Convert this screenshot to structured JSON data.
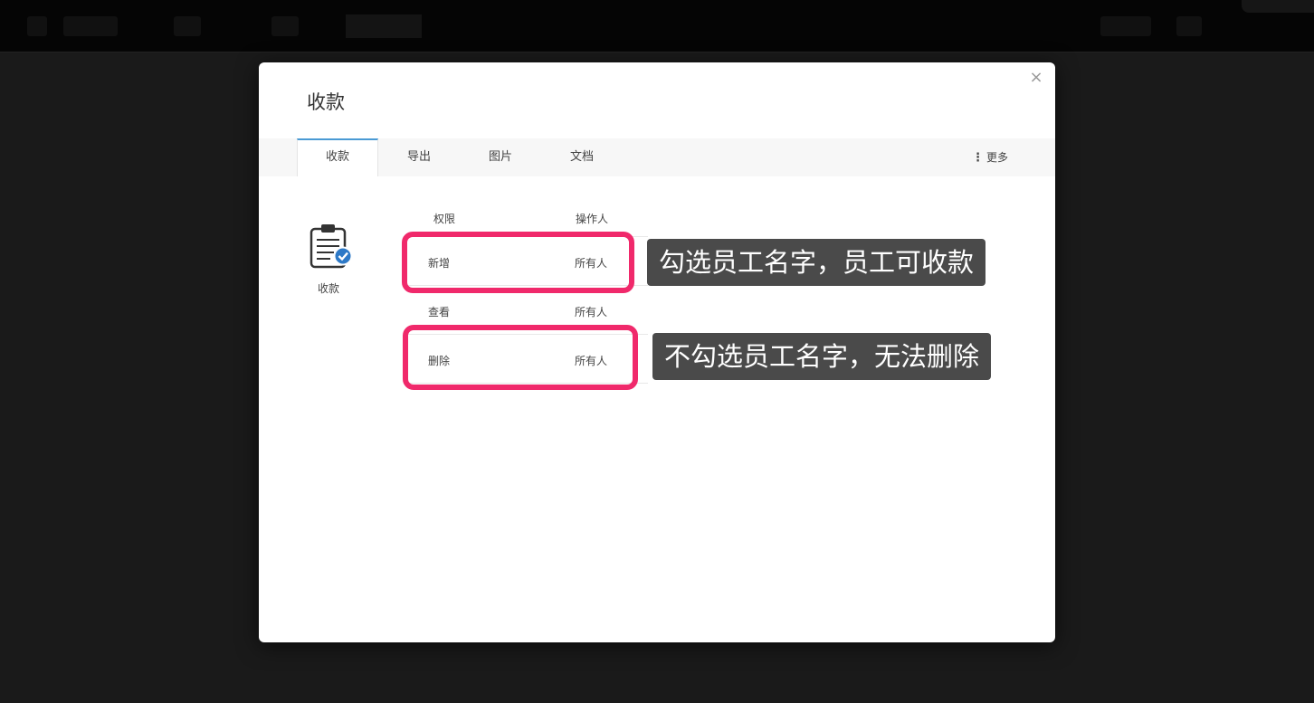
{
  "modal": {
    "title": "收款",
    "close_label": "×"
  },
  "tabs": [
    {
      "label": "收款",
      "active": true
    },
    {
      "label": "导出",
      "active": false
    },
    {
      "label": "图片",
      "active": false
    },
    {
      "label": "文档",
      "active": false
    }
  ],
  "tab_more": {
    "icon": "vertical-dots-icon",
    "label": "更多"
  },
  "side": {
    "icon": "clipboard-check-icon",
    "label": "收款"
  },
  "table": {
    "headers": {
      "permission": "权限",
      "operator": "操作人"
    },
    "rows": [
      {
        "permission": "新增",
        "operator": "所有人"
      },
      {
        "permission": "查看",
        "operator": "所有人"
      },
      {
        "permission": "删除",
        "operator": "所有人"
      }
    ]
  },
  "annotations": [
    "勾选员工名字，员工可收款",
    "不勾选员工名字，无法删除"
  ],
  "colors": {
    "highlight": "#f0296b",
    "callout_bg": "#4a4a4a",
    "accent": "#4a9ad4",
    "overlay": "#1a1a1a"
  }
}
